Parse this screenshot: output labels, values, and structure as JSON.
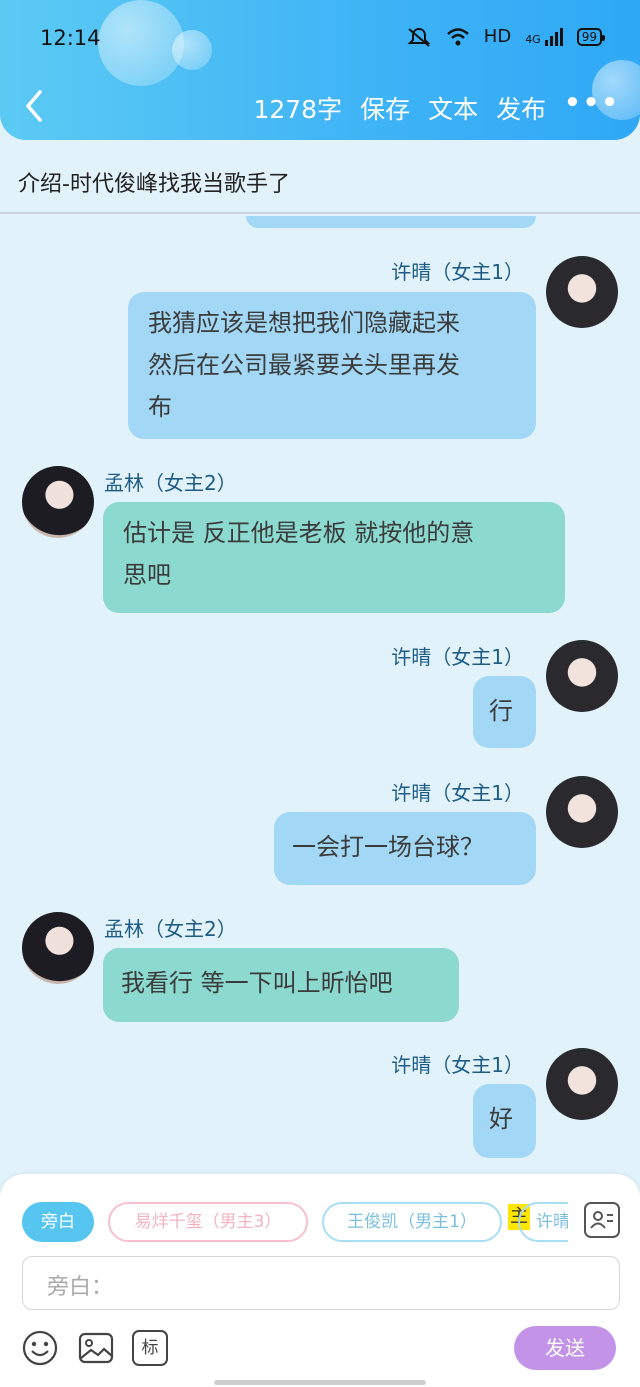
{
  "status_bar": {
    "time": "12:14",
    "network": "HD",
    "signal": "4G",
    "battery": "99"
  },
  "toolbar": {
    "word_count": "1278字",
    "save": "保存",
    "text": "文本",
    "publish": "发布"
  },
  "chapter_title": "介绍-时代俊峰找我当歌手了",
  "messages": [
    {
      "side": "right",
      "name": "许晴（女主1）",
      "lines": [
        "我猜应该是想把我们隐藏起来",
        "然后在公司最紧要关头里再发",
        "布"
      ]
    },
    {
      "side": "left",
      "name": "孟林（女主2）",
      "lines": [
        "估计是 反正他是老板 就按他的意",
        "思吧"
      ]
    },
    {
      "side": "right",
      "name": "许晴（女主1）",
      "lines": [
        "行"
      ]
    },
    {
      "side": "right",
      "name": "许晴（女主1）",
      "lines": [
        "一会打一场台球？"
      ]
    },
    {
      "side": "left",
      "name": "孟林（女主2）",
      "lines": [
        "我看行 等一下叫上昕怡吧"
      ]
    },
    {
      "side": "right",
      "name": "许晴（女主1）",
      "lines": [
        "好"
      ]
    }
  ],
  "roles": {
    "narration": "旁白",
    "role1": "易烊千玺（男主3）",
    "role2": "王俊凯（男主1）",
    "highlight": "主",
    "role3": "许晴"
  },
  "input": {
    "placeholder": "旁白："
  },
  "bottom": {
    "mark": "标",
    "send": "发送"
  },
  "colors": {
    "header": "#3eb3f6",
    "right_bubble": "#a2d8f5",
    "left_bubble": "#8bd9cf",
    "send": "#c393e8"
  }
}
